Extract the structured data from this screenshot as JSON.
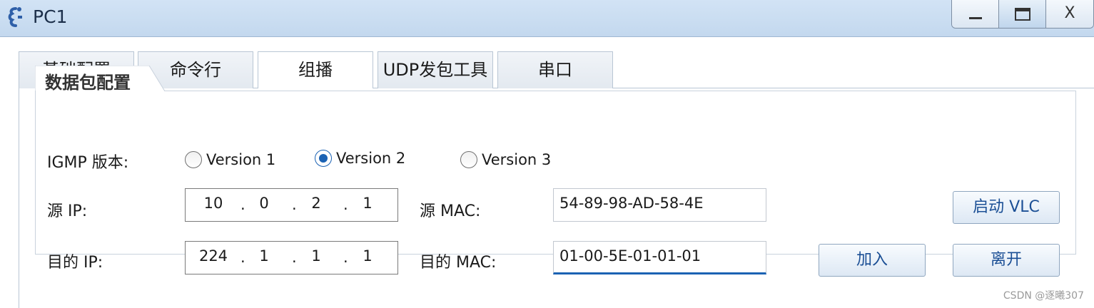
{
  "window": {
    "title": "PC1",
    "icon": "pc-icon",
    "controls": {
      "minimize": "minimize-icon",
      "maximize": "maximize-icon",
      "close": "X"
    }
  },
  "tabs": [
    {
      "label": "基础配置",
      "active": false
    },
    {
      "label": "命令行",
      "active": false
    },
    {
      "label": "组播",
      "active": true
    },
    {
      "label": "UDP发包工具",
      "active": false
    },
    {
      "label": "串口",
      "active": false
    }
  ],
  "packet_config": {
    "group_title": "数据包配置",
    "igmp_label": "IGMP 版本:",
    "versions": [
      {
        "label": "Version 1",
        "checked": false
      },
      {
        "label": "Version 2",
        "checked": true
      },
      {
        "label": "Version 3",
        "checked": false
      }
    ],
    "source_ip_label": "源 IP:",
    "source_ip": [
      "10",
      "0",
      "2",
      "1"
    ],
    "source_mac_label": "源  MAC:",
    "source_mac": "54-89-98-AD-58-4E",
    "dest_ip_label": "目的 IP:",
    "dest_ip": [
      "224",
      "1",
      "1",
      "1"
    ],
    "dest_mac_label": "目的 MAC:",
    "dest_mac": "01-00-5E-01-01-01",
    "ip_separator": ".",
    "buttons": {
      "start_vlc": "启动 VLC",
      "join": "加入",
      "leave": "离开"
    }
  },
  "watermark": "CSDN @逐曦307",
  "colors": {
    "accent": "#1b62b3",
    "titlebar": "#c9dcf0",
    "button_text": "#1b4f95"
  }
}
